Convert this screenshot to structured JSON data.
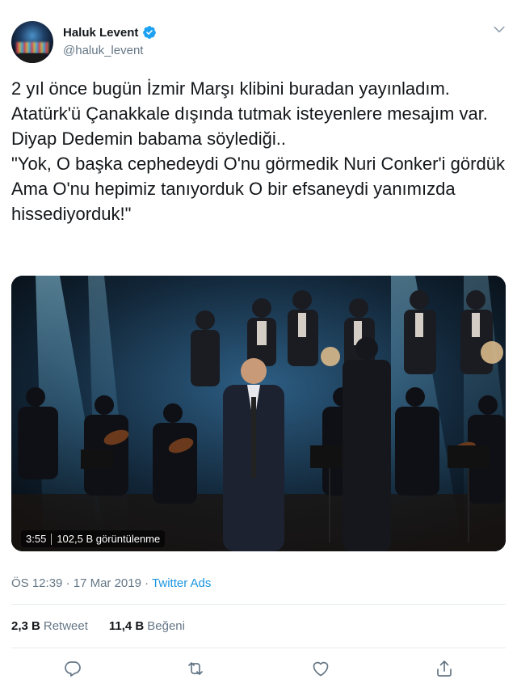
{
  "user": {
    "display_name": "Haluk Levent",
    "handle": "@haluk_levent",
    "verified": true
  },
  "tweet": {
    "text": "2 yıl önce bugün İzmir Marşı klibini buradan yayınladım.\nAtatürk'ü Çanakkale dışında tutmak isteyenlere mesajım var.\nDiyap Dedemin babama söylediği..\n\"Yok, O başka cephedeydi O'nu görmedik Nuri Conker'i gördük Ama O'nu hepimiz tanıyorduk O bir efsaneydi yanımızda hissediyorduk!\"",
    "time": "ÖS 12:39",
    "date": "17 Mar 2019",
    "separator": " · ",
    "source": "Twitter Ads"
  },
  "video": {
    "duration": "3:55",
    "views": "102,5 B görüntülenme"
  },
  "stats": {
    "retweets_count": "2,3 B",
    "retweets_label": "Retweet",
    "likes_count": "11,4 B",
    "likes_label": "Beğeni"
  },
  "icons": {
    "verified": "verified-badge-icon",
    "menu": "chevron-down-icon",
    "reply": "reply-icon",
    "retweet": "retweet-icon",
    "like": "heart-icon",
    "share": "share-icon"
  },
  "colors": {
    "accent": "#1b95e0",
    "text": "#14171a",
    "muted": "#657786"
  }
}
